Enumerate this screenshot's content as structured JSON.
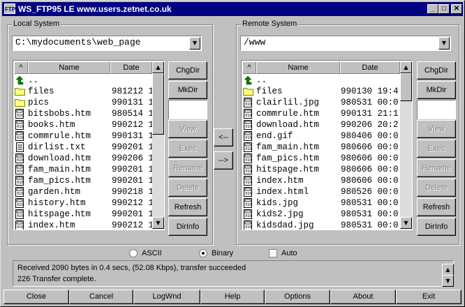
{
  "window": {
    "title": "WS_FTP95 LE www.users.zetnet.co.uk",
    "icon_text": "FTP"
  },
  "local": {
    "label": "Local System",
    "path": "C:\\mydocuments\\web_page",
    "headers": {
      "sort": "^",
      "name": "Name",
      "date": "Date"
    },
    "files": [
      {
        "icon": "up-arrow-icon",
        "name": "..",
        "date": ""
      },
      {
        "icon": "folder-icon",
        "name": "files",
        "date": "981212 1"
      },
      {
        "icon": "folder-icon",
        "name": "pics",
        "date": "990131 1"
      },
      {
        "icon": "file-icon",
        "name": "bitsbobs.htm",
        "date": "980514 1"
      },
      {
        "icon": "file-icon",
        "name": "books.htm",
        "date": "990212 1"
      },
      {
        "icon": "file-icon",
        "name": "commrule.htm",
        "date": "990131 1"
      },
      {
        "icon": "text-file-icon",
        "name": "dirlist.txt",
        "date": "990201 1"
      },
      {
        "icon": "file-icon",
        "name": "download.htm",
        "date": "990206 1"
      },
      {
        "icon": "file-icon",
        "name": "fam_main.htm",
        "date": "990201 1"
      },
      {
        "icon": "file-icon",
        "name": "fam_pics.htm",
        "date": "990201 1"
      },
      {
        "icon": "file-icon",
        "name": "garden.htm",
        "date": "990218 1"
      },
      {
        "icon": "file-icon",
        "name": "history.htm",
        "date": "990212 1"
      },
      {
        "icon": "file-icon",
        "name": "hitspage.htm",
        "date": "990201 1"
      },
      {
        "icon": "file-icon",
        "name": "index.htm",
        "date": "990212 1"
      }
    ],
    "buttons": {
      "chgdir": "ChgDir",
      "mkdir": "MkDir",
      "view": "View",
      "exec": "Exec",
      "rename": "Rename",
      "delete": "Delete",
      "refresh": "Refresh",
      "dirinfo": "DirInfo"
    }
  },
  "transfer": {
    "to_local": "<--",
    "to_remote": "-->"
  },
  "remote": {
    "label": "Remote System",
    "path": "/www",
    "headers": {
      "sort": "^",
      "name": "Name",
      "date": "Date"
    },
    "files": [
      {
        "icon": "up-arrow-icon",
        "name": "..",
        "date": ""
      },
      {
        "icon": "folder-icon",
        "name": "files",
        "date": "990130 19:4"
      },
      {
        "icon": "file-icon",
        "name": "clairlil.jpg",
        "date": "980531 00:0"
      },
      {
        "icon": "file-icon",
        "name": "commrule.htm",
        "date": "990131 21:1"
      },
      {
        "icon": "file-icon",
        "name": "download.htm",
        "date": "990206 20:2"
      },
      {
        "icon": "file-icon",
        "name": "end.gif",
        "date": "980406 00:0"
      },
      {
        "icon": "file-icon",
        "name": "fam_main.htm",
        "date": "980606 00:0"
      },
      {
        "icon": "file-icon",
        "name": "fam_pics.htm",
        "date": "980606 00:0"
      },
      {
        "icon": "file-icon",
        "name": "hitspage.htm",
        "date": "980606 00:0"
      },
      {
        "icon": "file-icon",
        "name": "index.htm",
        "date": "980606 00:0"
      },
      {
        "icon": "file-icon",
        "name": "index.html",
        "date": "980526 00:0"
      },
      {
        "icon": "file-icon",
        "name": "kids.jpg",
        "date": "980531 00:0"
      },
      {
        "icon": "file-icon",
        "name": "kids2.jpg",
        "date": "980531 00:0"
      },
      {
        "icon": "file-icon",
        "name": "kidsdad.jpg",
        "date": "980531 00:0"
      }
    ],
    "buttons": {
      "chgdir": "ChgDir",
      "mkdir": "MkDir",
      "view": "View",
      "exec": "Exec",
      "rename": "Rename",
      "delete": "Delete",
      "refresh": "Refresh",
      "dirinfo": "DirInfo"
    }
  },
  "mode": {
    "ascii": "ASCII",
    "binary": "Binary",
    "auto": "Auto",
    "selected": "binary",
    "auto_checked": false
  },
  "status": {
    "line1": "Received 2090 bytes in 0.4 secs, (52.08 Kbps), transfer succeeded",
    "line2": "226 Transfer complete."
  },
  "bottom_buttons": [
    {
      "id": "close",
      "label": "Close"
    },
    {
      "id": "cancel",
      "label": "Cancel"
    },
    {
      "id": "logwnd",
      "label": "LogWnd"
    },
    {
      "id": "help",
      "label": "Help"
    },
    {
      "id": "options",
      "label": "Options"
    },
    {
      "id": "about",
      "label": "About"
    },
    {
      "id": "exit",
      "label": "Exit"
    }
  ]
}
